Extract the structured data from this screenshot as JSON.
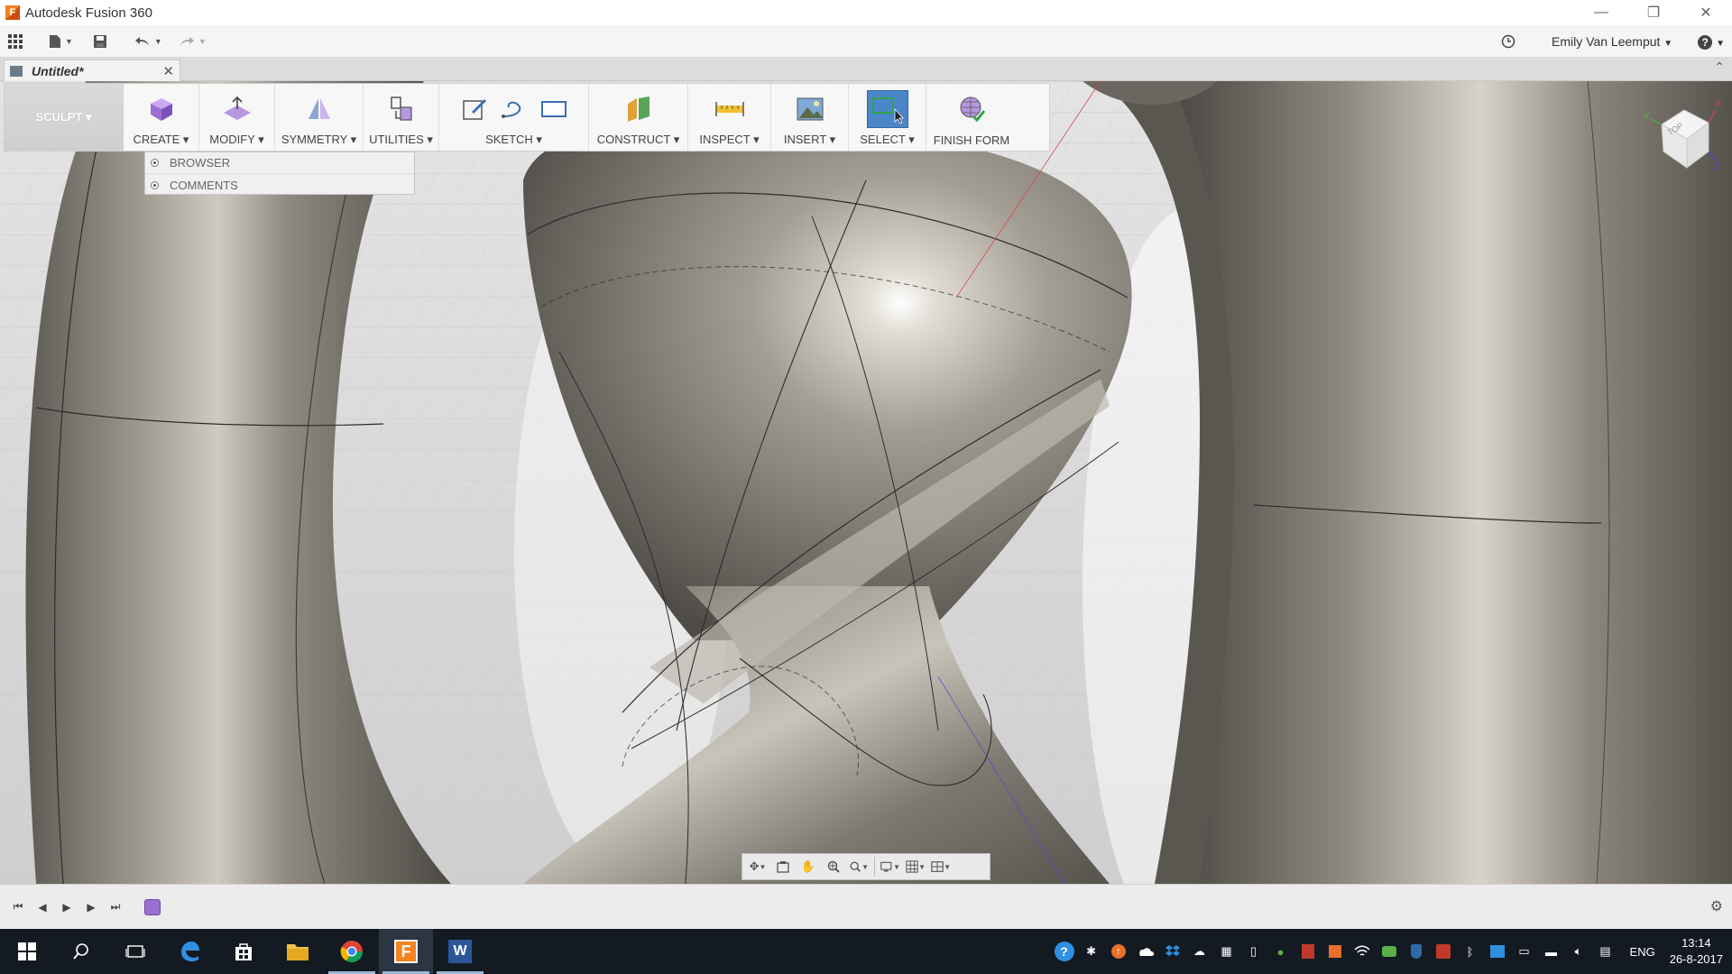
{
  "window": {
    "title": "Autodesk Fusion 360",
    "controls": {
      "minimize": "—",
      "restore": "❐",
      "close": "✕"
    }
  },
  "quick_access": {
    "user": "Emily Van Leemput",
    "user_caret": "▼",
    "help": "?",
    "help_caret": "▼"
  },
  "document_tab": {
    "title": "Untitled*",
    "close": "✕"
  },
  "ribbon": {
    "workspace": "SCULPT ▾",
    "groups": [
      {
        "label": "CREATE ▾",
        "icons": [
          "box-icon"
        ]
      },
      {
        "label": "MODIFY ▾",
        "icons": [
          "edit-form-icon"
        ]
      },
      {
        "label": "SYMMETRY ▾",
        "icons": [
          "symmetry-icon"
        ]
      },
      {
        "label": "UTILITIES ▾",
        "icons": [
          "utilities-icon"
        ]
      },
      {
        "label": "SKETCH ▾",
        "icons": [
          "create-sketch-icon",
          "spline-icon",
          "rectangle-icon"
        ]
      },
      {
        "label": "CONSTRUCT ▾",
        "icons": [
          "offset-plane-icon"
        ]
      },
      {
        "label": "INSPECT ▾",
        "icons": [
          "measure-icon"
        ]
      },
      {
        "label": "INSERT ▾",
        "icons": [
          "insert-image-icon"
        ]
      },
      {
        "label": "SELECT ▾",
        "icons": [
          "select-window-icon"
        ]
      },
      {
        "label": "FINISH FORM",
        "icons": [
          "finish-form-icon"
        ]
      }
    ]
  },
  "panel": {
    "items": [
      "BROWSER",
      "COMMENTS"
    ]
  },
  "viewcube": {
    "face": "TOP",
    "axis_x": "X",
    "axis_y": "Y",
    "axis_z": "Z"
  },
  "taskbar": {
    "language": "ENG",
    "time": "13:14",
    "date": "26-8-2017"
  },
  "colors": {
    "ribbon_bg": "#f7f7f7",
    "select_active": "#4a86c8",
    "taskbar_bg": "#141a22",
    "model_gray": "#8c877e"
  }
}
